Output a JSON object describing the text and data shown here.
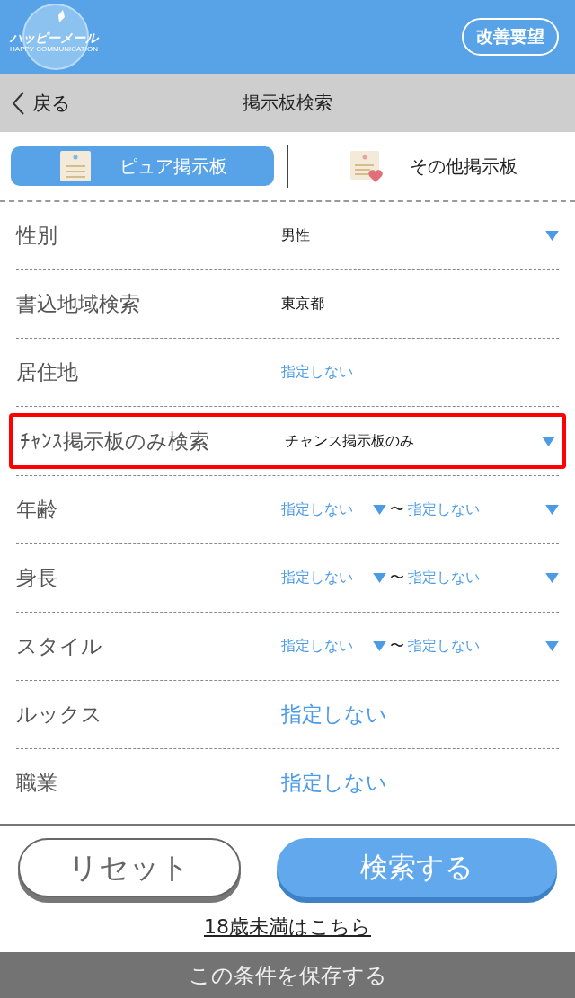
{
  "header": {
    "logo_text": "ハッピーメール",
    "logo_subtext": "HAPPY COMMUNICATION",
    "feedback_button": "改善要望"
  },
  "nav": {
    "back": "戻る",
    "title": "掲示板検索"
  },
  "tabs": [
    {
      "label": "ピュア掲示板",
      "selected": true,
      "kind": "pure"
    },
    {
      "label": "その他掲示板",
      "selected": false,
      "kind": "other"
    }
  ],
  "rows": [
    {
      "label": "性別",
      "kind": "select",
      "value": "男性",
      "highlighted": false
    },
    {
      "label": "書込地域検索",
      "kind": "plain",
      "value": "東京都",
      "highlighted": false
    },
    {
      "label": "居住地",
      "kind": "unset",
      "value": "指定しない",
      "highlighted": false
    },
    {
      "label": "ﾁｬﾝｽ掲示板のみ検索",
      "kind": "select",
      "value": "チャンス掲示板のみ",
      "highlighted": true
    },
    {
      "label": "年齢",
      "kind": "range",
      "from": "指定しない",
      "separator": "〜",
      "to": "指定しない",
      "highlighted": false
    },
    {
      "label": "身長",
      "kind": "range",
      "from": "指定しない",
      "separator": "〜",
      "to": "指定しない",
      "highlighted": false
    },
    {
      "label": "スタイル",
      "kind": "range",
      "from": "指定しない",
      "separator": "〜",
      "to": "指定しない",
      "highlighted": false
    },
    {
      "label": "ルックス",
      "kind": "unset-large",
      "value": "指定しない",
      "highlighted": false
    },
    {
      "label": "職業",
      "kind": "unset-large",
      "value": "指定しない",
      "highlighted": false
    }
  ],
  "footer": {
    "reset_button": "リセット",
    "search_button": "検索する",
    "under18_link": "18歳未満はこちら",
    "save_bar": "この条件を保存する"
  }
}
